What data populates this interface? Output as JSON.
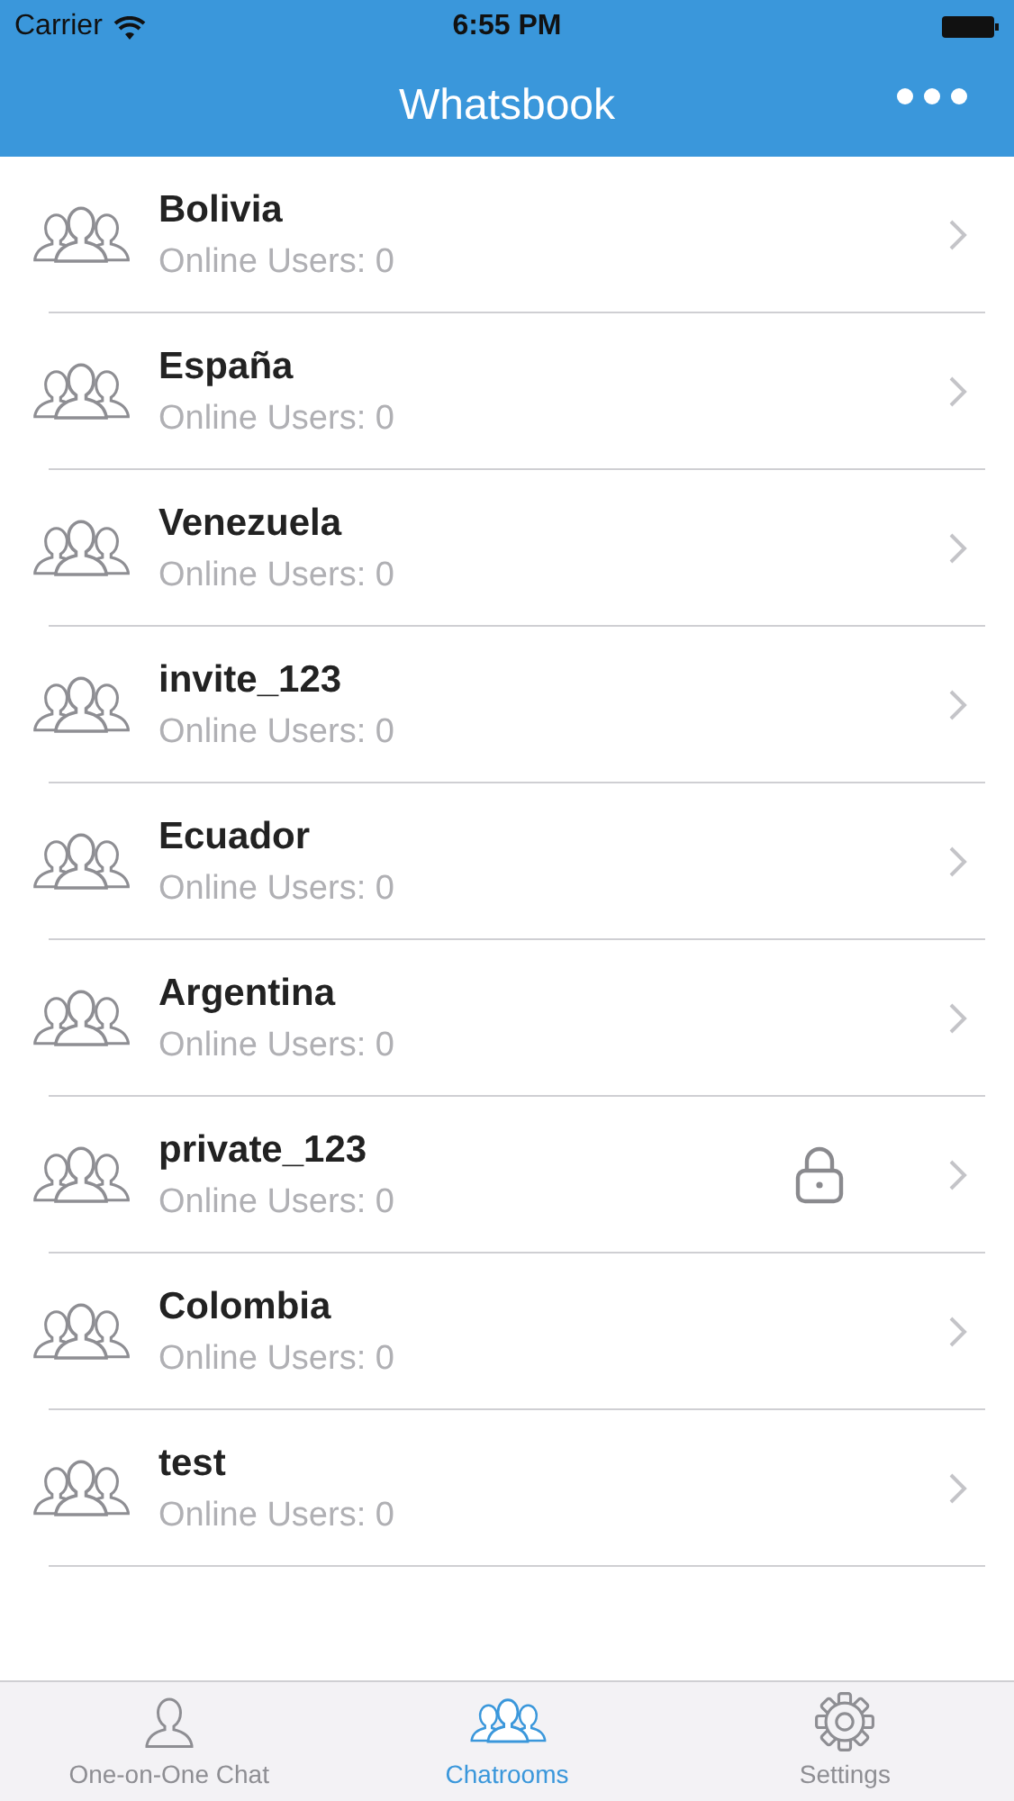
{
  "status_bar": {
    "carrier": "Carrier",
    "time": "6:55 PM"
  },
  "nav_bar": {
    "title": "Whatsbook"
  },
  "rooms": [
    {
      "name": "Bolivia",
      "subtitle": "Online Users: 0",
      "locked": false
    },
    {
      "name": "España",
      "subtitle": "Online Users: 0",
      "locked": false
    },
    {
      "name": "Venezuela",
      "subtitle": "Online Users: 0",
      "locked": false
    },
    {
      "name": "invite_123",
      "subtitle": "Online Users: 0",
      "locked": false
    },
    {
      "name": "Ecuador",
      "subtitle": "Online Users: 0",
      "locked": false
    },
    {
      "name": "Argentina",
      "subtitle": "Online Users: 0",
      "locked": false
    },
    {
      "name": "private_123",
      "subtitle": "Online Users: 0",
      "locked": true
    },
    {
      "name": "Colombia",
      "subtitle": "Online Users: 0",
      "locked": false
    },
    {
      "name": "test",
      "subtitle": "Online Users: 0",
      "locked": false
    }
  ],
  "tabs": [
    {
      "label": "One-on-One Chat",
      "kind": "person",
      "selected": false
    },
    {
      "label": "Chatrooms",
      "kind": "group",
      "selected": true
    },
    {
      "label": "Settings",
      "kind": "gear",
      "selected": false
    }
  ]
}
